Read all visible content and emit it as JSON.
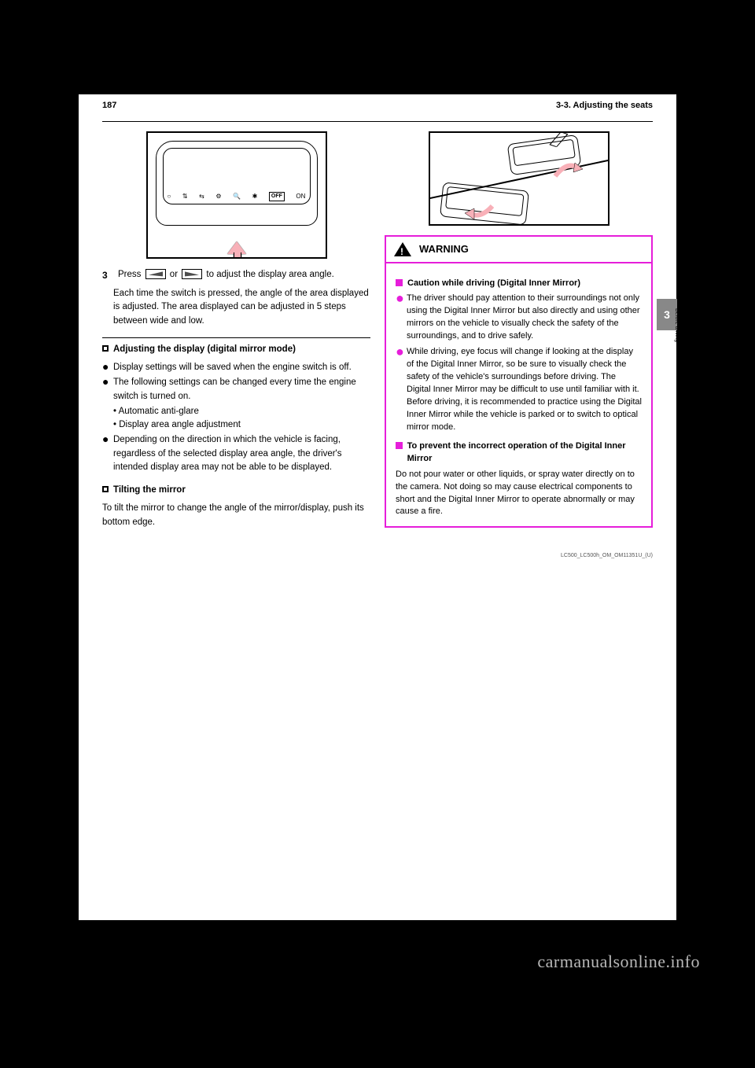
{
  "header": {
    "page_number": "187",
    "section": "3-3. Adjusting the seats"
  },
  "side_tab": {
    "num": "3",
    "label": "Before driving"
  },
  "left": {
    "mirror_labels": {
      "off": "OFF",
      "on": "ON"
    },
    "step3": {
      "num": "3",
      "pre": "Press ",
      "mid1": " or ",
      "post": " to adjust the display area angle."
    },
    "follow": "Each time the switch is pressed, the angle of the area displayed is adjusted. The area displayed can be adjusted in 5 steps between wide and low.",
    "adjust_h": "Adjusting the display (digital mirror mode)",
    "b1": "Display settings will be saved when the engine switch is off.",
    "b2": "The following settings can be changed every time the engine switch is turned on.",
    "b2a": "• Automatic anti-glare",
    "b2b": "• Display area angle adjustment",
    "b3": "Depending on the direction in which the vehicle is facing, regardless of the selected display area angle, the driver's intended display area may not be able to be displayed.",
    "tilt_h": "Tilting the mirror",
    "tilt_p": "To tilt the mirror to change the angle of the mirror/display, push its bottom edge."
  },
  "warning": {
    "title": "WARNING",
    "sec1_h": "Caution while driving (Digital Inner Mirror)",
    "sec1_b1": "The driver should pay attention to their surroundings not only using the Digital Inner Mirror but also directly and using other mirrors on the vehicle to visually check the safety of the surroundings, and to drive safely.",
    "sec1_b2": "While driving, eye focus will change if looking at the display of the Digital Inner Mirror, so be sure to visually check the safety of the vehicle's surroundings before driving. The Digital Inner Mirror may be difficult to use until familiar with it. Before driving, it is recommended to practice using the Digital Inner Mirror while the vehicle is parked or to switch to optical mirror mode.",
    "sec2_h": "To prevent the incorrect operation of the Digital Inner Mirror",
    "sec2_p": "Do not pour water or other liquids, or spray water directly on to the camera. Not doing so may cause electrical components to short and the Digital Inner Mirror to operate abnormally or may cause a fire."
  },
  "footer_tiny": "LC500_LC500h_OM_OM11351U_(U)",
  "watermark": "carmanualsonline.info"
}
